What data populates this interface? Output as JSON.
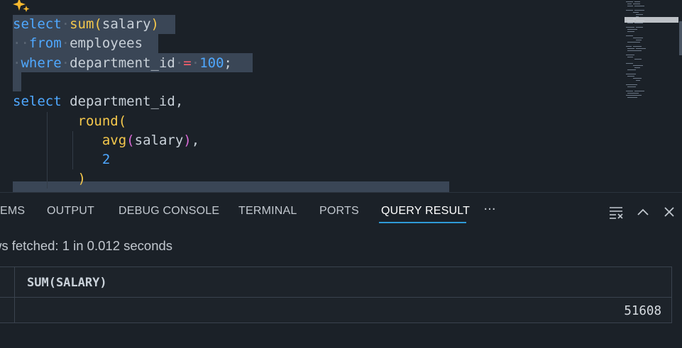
{
  "editor": {
    "lines": [
      {
        "tokens": [
          {
            "t": "select",
            "c": "kw"
          },
          {
            "t": "·",
            "c": "ws"
          },
          {
            "t": "sum",
            "c": "fn"
          },
          {
            "t": "(",
            "c": "br"
          },
          {
            "t": "salary",
            "c": "id"
          },
          {
            "t": ")",
            "c": "br"
          }
        ]
      },
      {
        "tokens": [
          {
            "t": "··",
            "c": "ws"
          },
          {
            "t": "from",
            "c": "kw"
          },
          {
            "t": "·",
            "c": "ws"
          },
          {
            "t": "employees",
            "c": "id"
          }
        ]
      },
      {
        "tokens": [
          {
            "t": "·",
            "c": "ws"
          },
          {
            "t": "where",
            "c": "kw"
          },
          {
            "t": "·",
            "c": "ws"
          },
          {
            "t": "department_id",
            "c": "id"
          },
          {
            "t": "·",
            "c": "ws"
          },
          {
            "t": "=",
            "c": "op"
          },
          {
            "t": "·",
            "c": "ws"
          },
          {
            "t": "100",
            "c": "num"
          },
          {
            "t": ";",
            "c": "pun"
          }
        ]
      },
      {
        "tokens": []
      },
      {
        "tokens": [
          {
            "t": "select",
            "c": "kw"
          },
          {
            "t": " ",
            "c": "id"
          },
          {
            "t": "department_id",
            "c": "id"
          },
          {
            "t": ",",
            "c": "pun"
          }
        ]
      },
      {
        "tokens": [
          {
            "t": "        ",
            "c": "id"
          },
          {
            "t": "round",
            "c": "fn"
          },
          {
            "t": "(",
            "c": "br"
          }
        ]
      },
      {
        "tokens": [
          {
            "t": "           ",
            "c": "id"
          },
          {
            "t": "avg",
            "c": "fn"
          },
          {
            "t": "(",
            "c": "br2"
          },
          {
            "t": "salary",
            "c": "id"
          },
          {
            "t": ")",
            "c": "br2"
          },
          {
            "t": ",",
            "c": "pun"
          }
        ]
      },
      {
        "tokens": [
          {
            "t": "           ",
            "c": "id"
          },
          {
            "t": "2",
            "c": "num"
          }
        ]
      },
      {
        "tokens": [
          {
            "t": "        ",
            "c": "id"
          },
          {
            "t": ")",
            "c": "br"
          }
        ]
      }
    ]
  },
  "panel": {
    "tabs": [
      {
        "label": "EMS"
      },
      {
        "label": "OUTPUT"
      },
      {
        "label": "DEBUG CONSOLE"
      },
      {
        "label": "TERMINAL"
      },
      {
        "label": "PORTS"
      },
      {
        "label": "QUERY RESULT"
      }
    ],
    "more_label": "···",
    "actions": {
      "clear": "clear-all-icon",
      "collapse": "chevron-up-icon",
      "close": "close-icon"
    },
    "status": "ws fetched: 1 in 0.012 seconds",
    "grid": {
      "columns": [
        "SUM(SALARY)"
      ],
      "rows": [
        [
          "51608"
        ]
      ]
    }
  },
  "colors": {
    "background": "#1b2128",
    "selection": "#3a4656",
    "keyword": "#4fa8ff",
    "function": "#f5c84c",
    "operator": "#ff5f6d",
    "active_tab_underline": "#2f9ad8"
  }
}
